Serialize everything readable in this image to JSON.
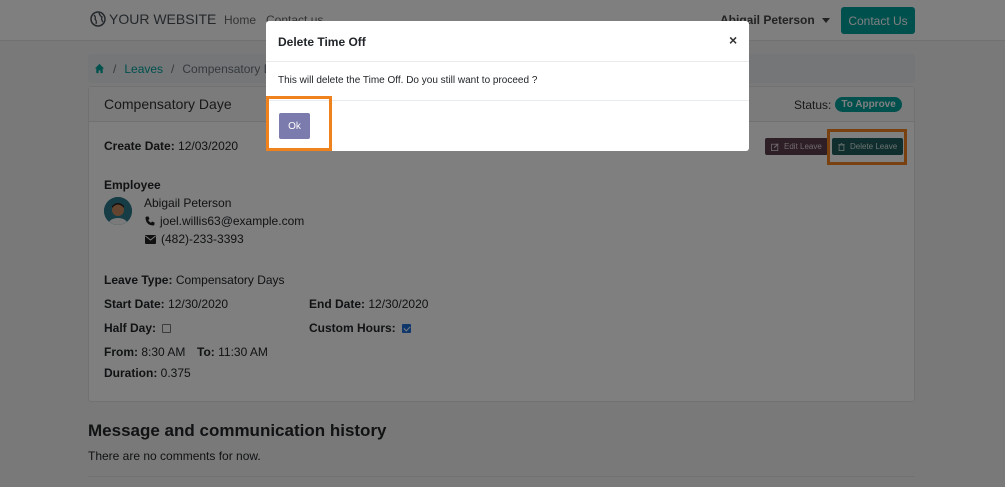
{
  "navbar": {
    "brand": "YOUR WEBSITE",
    "links": [
      "Home",
      "Contact us"
    ],
    "user_name": "Abigail Peterson",
    "contact_button": "Contact Us"
  },
  "breadcrumb": {
    "items": [
      "Leaves",
      "Compensatory D"
    ]
  },
  "leave": {
    "title": "Compensatory Daye",
    "status_label": "Status:",
    "status_value": "To Approve",
    "create_date_label": "Create Date:",
    "create_date": "12/03/2020",
    "edit_button": "Edit Leave",
    "delete_button": "Delete Leave",
    "employee_label": "Employee",
    "employee_name": "Abigail Peterson",
    "email": "joel.willis63@example.com",
    "phone": "(482)-233-3393",
    "leave_type_label": "Leave Type:",
    "leave_type": "Compensatory Days",
    "start_date_label": "Start Date:",
    "start_date": "12/30/2020",
    "end_date_label": "End Date:",
    "end_date": "12/30/2020",
    "half_day_label": "Half Day:",
    "custom_hours_label": "Custom Hours:",
    "from_label": "From:",
    "from_value": "8:30 AM",
    "to_label": "To:",
    "to_value": "11:30 AM",
    "duration_label": "Duration:",
    "duration": "0.375"
  },
  "messages": {
    "title": "Message and communication history",
    "empty_text": "There are no comments for now."
  },
  "modal": {
    "title": "Delete Time Off",
    "close": "×",
    "body": "This will delete the Time Off. Do you still want to proceed ?",
    "ok_button": "Ok"
  },
  "colors": {
    "accent": "#00a09d",
    "highlight": "#f0821e",
    "ok_button": "#7c7bad"
  }
}
